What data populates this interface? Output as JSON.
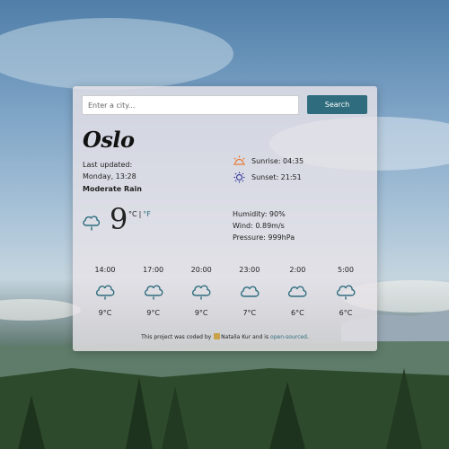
{
  "search": {
    "placeholder": "Enter a city...",
    "button_label": "Search"
  },
  "weather": {
    "city": "Oslo",
    "updated_label": "Last updated:",
    "updated_time": "Monday, 13:28",
    "description": "Moderate Rain",
    "sunrise": "Sunrise: 04:35",
    "sunset": "Sunset: 21:51",
    "temperature": "9",
    "unit_celsius": "°C",
    "unit_separator": "|",
    "unit_fahrenheit": "°F",
    "humidity": "Humidity: 90%",
    "wind": "Wind: 0.89m/s",
    "pressure": "Pressure: 999hPa",
    "current_icon": "rain-cloud-icon"
  },
  "forecast": [
    {
      "time": "14:00",
      "temp": "9°C",
      "icon": "cloud-icon"
    },
    {
      "time": "17:00",
      "temp": "9°C",
      "icon": "cloud-icon"
    },
    {
      "time": "20:00",
      "temp": "9°C",
      "icon": "cloud-icon"
    },
    {
      "time": "23:00",
      "temp": "7°C",
      "icon": "cloud-icon"
    },
    {
      "time": "2:00",
      "temp": "6°C",
      "icon": "cloud-icon"
    },
    {
      "time": "5:00",
      "temp": "6°C",
      "icon": "cloud-icon"
    }
  ],
  "footer": {
    "prefix": "This project was coded by",
    "author": "Natalia Kur",
    "middle": "and is",
    "link": "open-sourced",
    "suffix": "."
  },
  "colors": {
    "accent": "#2f6d7e",
    "sunrise": "#e8762b",
    "sunset": "#3b3b9e"
  }
}
